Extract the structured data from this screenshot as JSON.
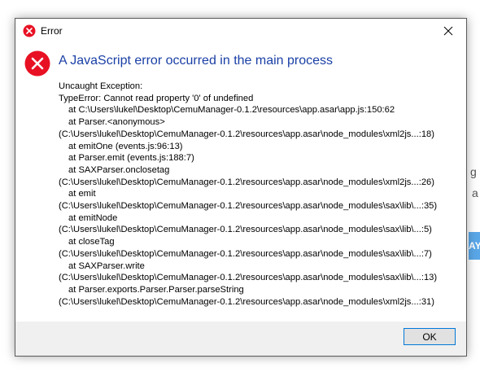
{
  "background": {
    "fragment_g": "g",
    "fragment_a": "a",
    "button_fragment": "AY"
  },
  "dialog": {
    "title": "Error",
    "title_icon": "error-icon",
    "close_icon": "close-icon",
    "heading": "A JavaScript error occurred in the main process",
    "lines": [
      {
        "text": "Uncaught Exception:",
        "indent": false
      },
      {
        "text": "TypeError: Cannot read property '0' of undefined",
        "indent": false
      },
      {
        "text": "at C:\\Users\\lukel\\Desktop\\CemuManager-0.1.2\\resources\\app.asar\\app.js:150:62",
        "indent": true
      },
      {
        "text": "at Parser.<anonymous>",
        "indent": true
      },
      {
        "text": "(C:\\Users\\lukel\\Desktop\\CemuManager-0.1.2\\resources\\app.asar\\node_modules\\xml2js...:18)",
        "indent": false
      },
      {
        "text": "at emitOne (events.js:96:13)",
        "indent": true
      },
      {
        "text": "at Parser.emit (events.js:188:7)",
        "indent": true
      },
      {
        "text": "at SAXParser.onclosetag",
        "indent": true
      },
      {
        "text": "(C:\\Users\\lukel\\Desktop\\CemuManager-0.1.2\\resources\\app.asar\\node_modules\\xml2js...:26)",
        "indent": false
      },
      {
        "text": "at emit",
        "indent": true
      },
      {
        "text": "(C:\\Users\\lukel\\Desktop\\CemuManager-0.1.2\\resources\\app.asar\\node_modules\\sax\\lib\\...:35)",
        "indent": false
      },
      {
        "text": "at emitNode",
        "indent": true
      },
      {
        "text": "(C:\\Users\\lukel\\Desktop\\CemuManager-0.1.2\\resources\\app.asar\\node_modules\\sax\\lib\\...:5)",
        "indent": false
      },
      {
        "text": "at closeTag",
        "indent": true
      },
      {
        "text": "(C:\\Users\\lukel\\Desktop\\CemuManager-0.1.2\\resources\\app.asar\\node_modules\\sax\\lib\\...:7)",
        "indent": false
      },
      {
        "text": "at SAXParser.write",
        "indent": true
      },
      {
        "text": "(C:\\Users\\lukel\\Desktop\\CemuManager-0.1.2\\resources\\app.asar\\node_modules\\sax\\lib\\...:13)",
        "indent": false
      },
      {
        "text": "at Parser.exports.Parser.Parser.parseString",
        "indent": true
      },
      {
        "text": "(C:\\Users\\lukel\\Desktop\\CemuManager-0.1.2\\resources\\app.asar\\node_modules\\xml2js...:31)",
        "indent": false
      }
    ],
    "ok_label": "OK",
    "colors": {
      "error_red": "#e81123",
      "heading_blue": "#1a3fa6",
      "footer_bg": "#f0f0f0",
      "button_border": "#0078d7"
    }
  }
}
